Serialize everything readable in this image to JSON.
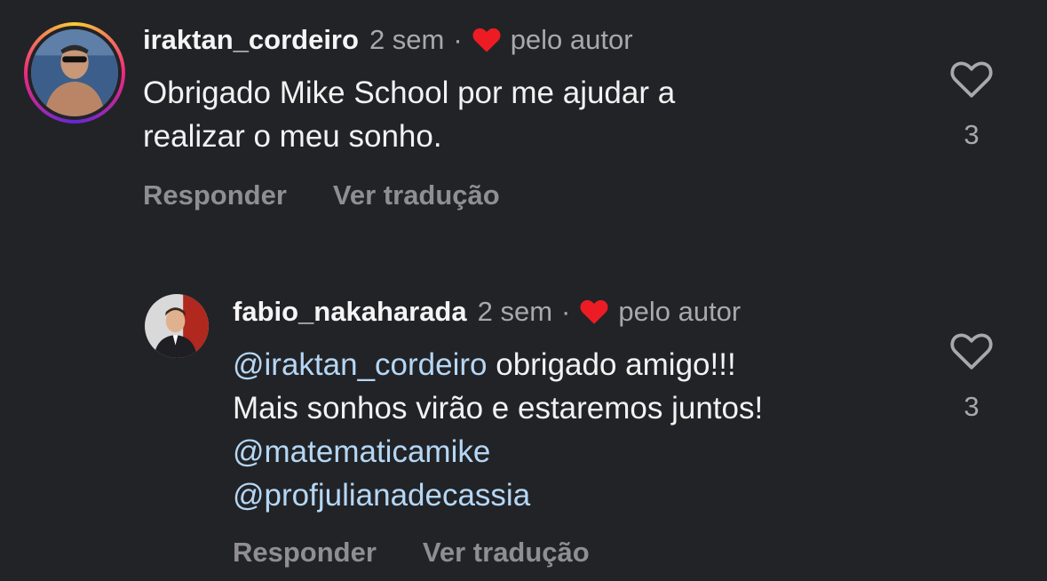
{
  "colors": {
    "background": "#222327",
    "username": "#f5f5f5",
    "meta": "#a8a8ad",
    "mention": "#b5d7f5",
    "heart": "#ed1c24",
    "actions": "#8e8e93"
  },
  "comments": [
    {
      "username": "iraktan_cordeiro",
      "time": "2 sem",
      "separator": "·",
      "liked_by_author": "pelo autor",
      "lines": [
        {
          "parts": [
            {
              "text": "Obrigado Mike School por me ajudar a",
              "mention": false
            }
          ]
        },
        {
          "parts": [
            {
              "text": "realizar o meu sonho.",
              "mention": false
            }
          ]
        }
      ],
      "reply_label": "Responder",
      "translate_label": "Ver tradução",
      "like_icon": "heart-outline-icon",
      "like_count": "3",
      "has_story_ring": true
    },
    {
      "username": "fabio_nakaharada",
      "time": "2 sem",
      "separator": "·",
      "liked_by_author": "pelo autor",
      "lines": [
        {
          "parts": [
            {
              "text": "@iraktan_cordeiro",
              "mention": true
            },
            {
              "text": " obrigado amigo!!!",
              "mention": false
            }
          ]
        },
        {
          "parts": [
            {
              "text": "Mais sonhos virão e estaremos juntos!",
              "mention": false
            }
          ]
        },
        {
          "parts": [
            {
              "text": "@matematicamike",
              "mention": true
            }
          ]
        },
        {
          "parts": [
            {
              "text": "@profjulianadecassia",
              "mention": true
            }
          ]
        }
      ],
      "reply_label": "Responder",
      "translate_label": "Ver tradução",
      "like_icon": "heart-outline-icon",
      "like_count": "3",
      "has_story_ring": false
    }
  ]
}
